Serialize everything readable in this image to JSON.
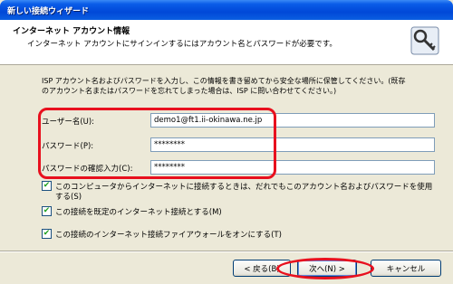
{
  "window": {
    "title": "新しい接続ウィザード"
  },
  "header": {
    "title": "インターネット アカウント情報",
    "subtitle": "インターネット アカウントにサインインするにはアカウント名とパスワードが必要です。",
    "icon": "key-icon"
  },
  "description": [
    "ISP アカウント名およびパスワードを入力し、この情報を書き留めてから安全な場所に保管してください。(既存",
    "のアカウント名またはパスワードを忘れてしまった場合は、ISP に問い合わせてください。)"
  ],
  "form": {
    "username_label": "ユーザー名(U):",
    "username_value": "demo1@ft1.ii-okinawa.ne.jp",
    "password_label": "パスワード(P):",
    "password_value": "********",
    "confirm_label": "パスワードの確認入力(C):",
    "confirm_value": "********"
  },
  "options": [
    {
      "label_line1": "このコンピュータからインターネットに接続するときは、だれでもこのアカウント名およびパスワードを使用",
      "label_line2": "する(S)",
      "checked": true
    },
    {
      "label_line1": "この接続を既定のインターネット接続とする(M)",
      "checked": true
    },
    {
      "label_line1": "この接続のインターネット接続ファイアウォールをオンにする(T)",
      "checked": true
    }
  ],
  "buttons": {
    "back": "< 戻る(B)",
    "next": "次へ(N) >",
    "cancel": "キャンセル"
  },
  "colors": {
    "title_bar": "#0a5ce8",
    "highlight": "#e8101e",
    "dialog_bg": "#ece9d8"
  }
}
